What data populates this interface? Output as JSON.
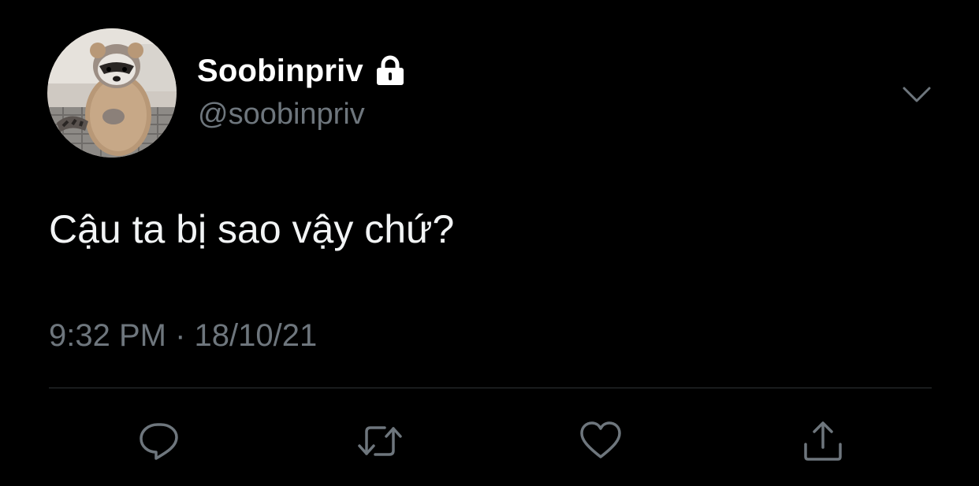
{
  "tweet": {
    "display_name": "Soobinpriv",
    "handle": "@soobinpriv",
    "text": "Cậu ta bị sao vậy chứ?",
    "timestamp": "9:32 PM · 18/10/21",
    "protected_icon": "lock-icon",
    "avatar_description": "raccoon-avatar"
  },
  "actions": {
    "reply_icon": "reply-icon",
    "retweet_icon": "retweet-icon",
    "like_icon": "heart-icon",
    "share_icon": "share-icon",
    "more_icon": "chevron-down-icon"
  },
  "colors": {
    "background": "#000000",
    "primary_text": "#ffffff",
    "secondary_text": "#6e767d",
    "divider": "#2f3336"
  }
}
